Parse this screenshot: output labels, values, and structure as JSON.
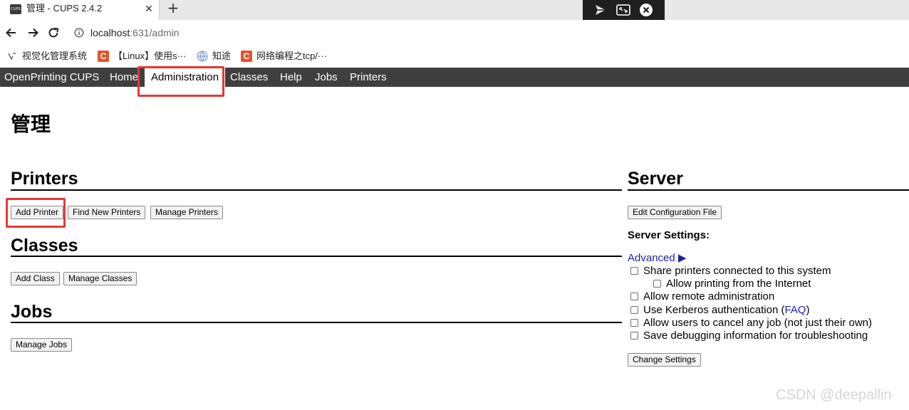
{
  "browser": {
    "tab": {
      "title": "管理 - CUPS 2.4.2",
      "favicon_label": "CUPS",
      "close_icon": "close-icon"
    },
    "new_tab_icon": "plus-icon",
    "address": {
      "host": "localhost",
      "path": ":631/admin"
    },
    "bookmarks": [
      {
        "label": "视觉化管理系统",
        "icon": "bookmark-generic-icon"
      },
      {
        "label": "【Linux】使用s···",
        "icon": "csdn-icon",
        "icon_text": "C"
      },
      {
        "label": "知途",
        "icon": "globe-icon"
      },
      {
        "label": "网络编程之tcp/···",
        "icon": "csdn-icon",
        "icon_text": "C"
      }
    ]
  },
  "cups_nav": {
    "items": [
      "OpenPrinting CUPS",
      "Home",
      "Administration",
      "Classes",
      "Help",
      "Jobs",
      "Printers"
    ],
    "active": "Administration"
  },
  "page": {
    "title": "管理",
    "printers": {
      "heading": "Printers",
      "buttons": [
        "Add Printer",
        "Find New Printers",
        "Manage Printers"
      ]
    },
    "classes": {
      "heading": "Classes",
      "buttons": [
        "Add Class",
        "Manage Classes"
      ]
    },
    "jobs": {
      "heading": "Jobs",
      "buttons": [
        "Manage Jobs"
      ]
    },
    "server": {
      "heading": "Server",
      "edit_config_button": "Edit Configuration File",
      "settings_heading": "Server Settings:",
      "advanced_label": "Advanced ▶",
      "options": [
        {
          "label": "Share printers connected to this system",
          "checked": false
        },
        {
          "label": "Allow printing from the Internet",
          "checked": false
        },
        {
          "label": "Allow remote administration",
          "checked": false
        },
        {
          "label": "Use Kerberos authentication (",
          "link": "FAQ",
          "suffix": ")",
          "checked": false
        },
        {
          "label": "Allow users to cancel any job (not just their own)",
          "checked": false
        },
        {
          "label": "Save debugging information for troubleshooting",
          "checked": false
        }
      ],
      "change_settings_button": "Change Settings"
    }
  },
  "annotation_color": "#e53935",
  "watermark": "CSDN @deepallin"
}
